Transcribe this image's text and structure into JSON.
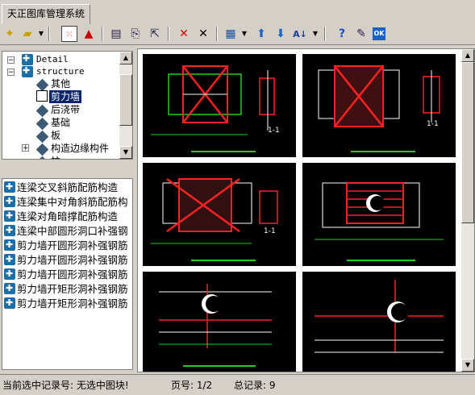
{
  "tab": {
    "label": "天正图库管理系统"
  },
  "toolbar": {
    "buttons": [
      "new-icon",
      "open-folder-icon",
      "dropdown-arrow",
      "grid-pick-icon",
      "triangle-icon",
      "table-icon",
      "export-icon",
      "import-icon",
      "delete-red-icon",
      "delete-icon",
      "view-grid-icon",
      "dropdown-arrow",
      "up-arrow-icon",
      "down-arrow-icon",
      "sort-az-icon",
      "dropdown-arrow",
      "help-icon",
      "edit-icon",
      "ok-icon"
    ],
    "ok_label": "OK"
  },
  "tree": {
    "root1": "Detail",
    "root2": "structure",
    "items": [
      "其他",
      "剪力墙",
      "后浇带",
      "基础",
      "板",
      "构造边缘构件",
      "柱"
    ],
    "selected": "剪力墙"
  },
  "list": {
    "items": [
      "连梁交叉斜筋配筋构造",
      "连梁集中对角斜筋配筋构",
      "连梁对角暗撑配筋构造",
      "连梁中部圆形洞口补强钢",
      "剪力墙开圆形洞补强钢筋",
      "剪力墙开圆形洞补强钢筋",
      "剪力墙开圆形洞补强钢筋",
      "剪力墙开矩形洞补强钢筋",
      "剪力墙开矩形洞补强钢筋"
    ]
  },
  "gallery": {
    "labels": [
      "1-1",
      "1-1",
      "1-1"
    ]
  },
  "status": {
    "current_record": "当前选中记录号: 无选中图块!",
    "page": "页号: 1/2",
    "total": "总记录:  9"
  },
  "colors": {
    "selection": "#0a246a",
    "drawing_bg": "#000000",
    "rebar_red": "#ff2020",
    "line_green": "#22cc22",
    "line_white": "#ffffff"
  }
}
